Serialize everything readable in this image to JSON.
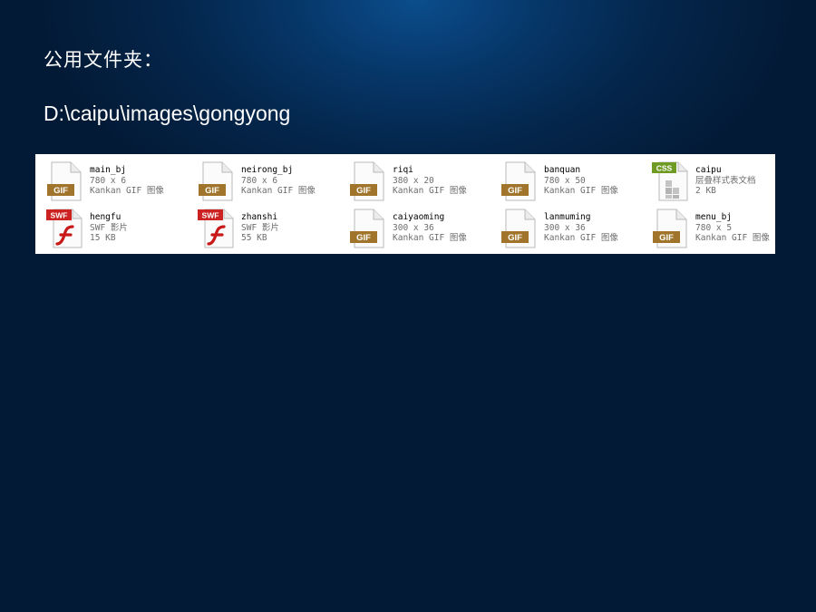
{
  "slide": {
    "heading": "公用文件夹：",
    "path": "D:\\caipu\\images\\gongyong"
  },
  "files": [
    {
      "name": "main_bj",
      "line1": "780 x 6",
      "line2": "Kankan GIF 图像",
      "icon": "gif-file-icon",
      "badge": "GIF"
    },
    {
      "name": "neirong_bj",
      "line1": "780 x 6",
      "line2": "Kankan GIF 图像",
      "icon": "gif-file-icon",
      "badge": "GIF"
    },
    {
      "name": "riqi",
      "line1": "380 x 20",
      "line2": "Kankan GIF 图像",
      "icon": "gif-file-icon",
      "badge": "GIF"
    },
    {
      "name": "banquan",
      "line1": "780 x 50",
      "line2": "Kankan GIF 图像",
      "icon": "gif-file-icon",
      "badge": "GIF"
    },
    {
      "name": "caipu",
      "line1": "层叠样式表文档",
      "line2": "2 KB",
      "icon": "css-file-icon",
      "badge": "CSS"
    },
    {
      "name": "hengfu",
      "line1": "SWF 影片",
      "line2": "15 KB",
      "icon": "swf-file-icon",
      "badge": "SWF"
    },
    {
      "name": "zhanshi",
      "line1": "SWF 影片",
      "line2": "55 KB",
      "icon": "swf-file-icon",
      "badge": "SWF"
    },
    {
      "name": "caiyaoming",
      "line1": "300 x 36",
      "line2": "Kankan GIF 图像",
      "icon": "gif-file-icon",
      "badge": "GIF"
    },
    {
      "name": "lanmuming",
      "line1": "300 x 36",
      "line2": "Kankan GIF 图像",
      "icon": "gif-file-icon",
      "badge": "GIF"
    },
    {
      "name": "menu_bj",
      "line1": "780 x 5",
      "line2": "Kankan GIF 图像",
      "icon": "gif-file-icon",
      "badge": "GIF"
    }
  ],
  "colors": {
    "gif_badge": "#a0752b",
    "css_badge": "#6f9b25",
    "swf_badge": "#cc2222",
    "flash_f": "#c81818"
  }
}
